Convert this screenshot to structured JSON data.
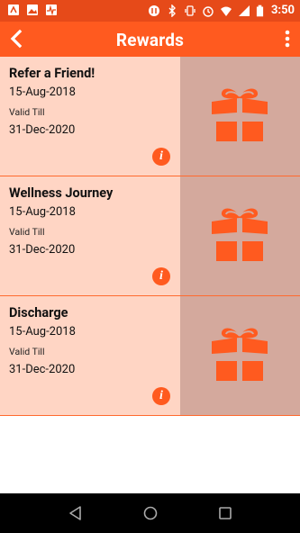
{
  "status_bar": {
    "time": "3:50",
    "left_icons": [
      "notification-icon",
      "gallery-icon",
      "health-icon"
    ],
    "right_icons": [
      "sync-icon",
      "bluetooth-icon",
      "vibrate-icon",
      "alarm-icon",
      "wifi-icon",
      "signal-icon",
      "battery-icon"
    ]
  },
  "app_bar": {
    "title": "Rewards",
    "back_icon": "back-arrow-icon",
    "menu_icon": "more-vertical-icon"
  },
  "rewards": [
    {
      "title": "Refer a Friend!",
      "date": "15-Aug-2018",
      "valid_label": "Valid Till",
      "expiry": "31-Dec-2020",
      "info": "i",
      "icon": "gift-icon"
    },
    {
      "title": "Wellness Journey",
      "date": "15-Aug-2018",
      "valid_label": "Valid Till",
      "expiry": "31-Dec-2020",
      "info": "i",
      "icon": "gift-icon"
    },
    {
      "title": "Discharge",
      "date": "15-Aug-2018",
      "valid_label": "Valid Till",
      "expiry": "31-Dec-2020",
      "info": "i",
      "icon": "gift-icon"
    }
  ],
  "colors": {
    "status_bar": "#e64a19",
    "app_bar": "#ff5a1f",
    "card_bg": "#ffd5c4",
    "card_icon_bg": "#d4a99d",
    "accent": "#ff5a1f"
  },
  "nav_bar": {
    "buttons": [
      "back-nav-icon",
      "home-nav-icon",
      "recents-nav-icon"
    ]
  }
}
